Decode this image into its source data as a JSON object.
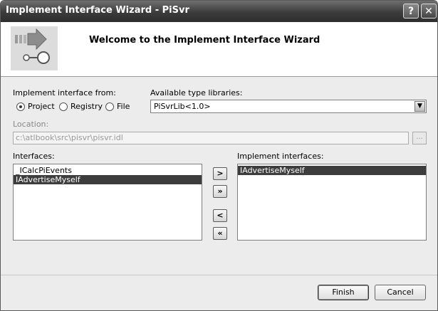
{
  "window": {
    "title": "Implement Interface Wizard - PiSvr",
    "help_glyph": "?",
    "close_glyph": "✕"
  },
  "header": {
    "welcome": "Welcome to the Implement Interface Wizard",
    "graphic_icon": "wizard-arrow-connector-icon"
  },
  "implement_from": {
    "label": "Implement interface from:",
    "options": [
      {
        "label": "Project",
        "selected": true
      },
      {
        "label": "Registry",
        "selected": false
      },
      {
        "label": "File",
        "selected": false
      }
    ]
  },
  "type_libraries": {
    "label": "Available type libraries:",
    "selected": "PiSvrLib<1.0>",
    "dropdown_glyph": "▼"
  },
  "location": {
    "label": "Location:",
    "value": "c:\\atlbook\\src\\pisvr\\pisvr.idl",
    "browse_label": "..."
  },
  "interfaces": {
    "label": "Interfaces:",
    "items": [
      {
        "label": "_ICalcPiEvents",
        "selected": false
      },
      {
        "label": "IAdvertiseMyself",
        "selected": true
      }
    ]
  },
  "implement_interfaces": {
    "label": "Implement interfaces:",
    "items": [
      {
        "label": "IAdvertiseMyself",
        "selected": true
      }
    ]
  },
  "move_buttons": {
    "add": ">",
    "add_all": "»",
    "remove": "<",
    "remove_all": "«"
  },
  "footer": {
    "finish": "Finish",
    "cancel": "Cancel"
  },
  "colors": {
    "titlebar": "#3b3b3b",
    "selection": "#3d3d3d",
    "dialog_bg": "#ececec"
  }
}
